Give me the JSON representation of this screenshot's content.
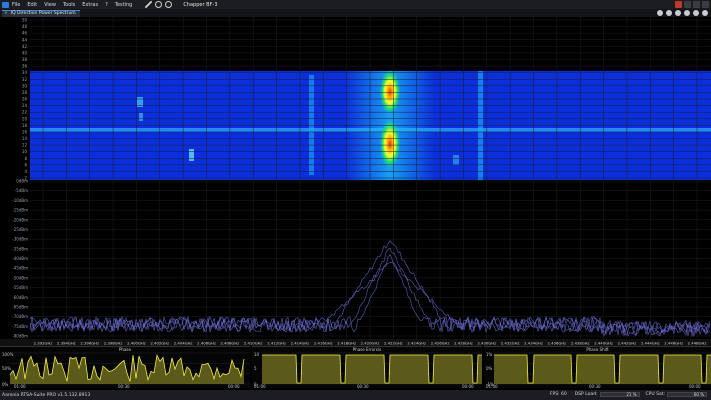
{
  "menu": [
    "File",
    "Edit",
    "View",
    "Tools",
    "Extras",
    "?",
    "Testing"
  ],
  "device_name": "Chapper BF-3",
  "tab_title": "IQ Direction Power Spectrum",
  "waterfall": {
    "y_ticks": [
      "50",
      "48",
      "46",
      "44",
      "42",
      "40",
      "38",
      "36",
      "34",
      "32",
      "30",
      "28",
      "26",
      "24",
      "22",
      "20",
      "18",
      "16",
      "14",
      "12",
      "10",
      "8",
      "6",
      "4",
      "2"
    ]
  },
  "spectrum": {
    "y_ticks": [
      "0dBm",
      "-5dBm",
      "-10dBm",
      "-15dBm",
      "-20dBm",
      "-25dBm",
      "-30dBm",
      "-35dBm",
      "-40dBm",
      "-45dBm",
      "-50dBm",
      "-55dBm",
      "-60dBm",
      "-65dBm",
      "-70dBm",
      "-75dBm",
      "-80dBm"
    ]
  },
  "freq_ticks": [
    "2.392GHz",
    "2.394GHz",
    "2.396GHz",
    "2.398GHz",
    "2.400GHz",
    "2.402GHz",
    "2.404GHz",
    "2.406GHz",
    "2.408GHz",
    "2.410GHz",
    "2.412GHz",
    "2.414GHz",
    "2.416GHz",
    "2.418GHz",
    "2.420GHz",
    "2.422GHz",
    "2.424GHz",
    "2.426GHz",
    "2.428GHz",
    "2.430GHz",
    "2.432GHz",
    "2.434GHz",
    "2.436GHz",
    "2.438GHz",
    "2.440GHz",
    "2.442GHz",
    "2.444GHz",
    "2.446GHz",
    "2.448GHz"
  ],
  "mini_charts": [
    {
      "title": "Phase",
      "y_top": "100%",
      "y_mid": "50%",
      "y_bot": "0%",
      "x_ticks": [
        "01:00",
        "00:30",
        "00:00"
      ]
    },
    {
      "title": "Phase Errors/s",
      "y_top": "10",
      "y_mid": "5",
      "y_bot": "0",
      "x_ticks": [
        "01:00",
        "00:30",
        "00:00"
      ]
    },
    {
      "title": "Phase Shift",
      "y_top": "1%",
      "y_mid": "0%",
      "y_bot": "-1%",
      "x_ticks": [
        "01:00",
        "00:30",
        "00:00"
      ]
    }
  ],
  "status": {
    "version": "Aaronia RTSA-Suite PRO v1.5.132.8913",
    "fps_label": "FPS: 60",
    "dsp_label": "DSP Load:",
    "dsp_value": "21 %",
    "cpu_label": "CPU Sat:",
    "cpu_value": "60 %"
  },
  "colors": {
    "waterfall_bg": "#0a2ad8",
    "trace": "#6d6fd6",
    "mini_fill": "#6b6a1f",
    "mini_line": "#f2ee4c"
  }
}
